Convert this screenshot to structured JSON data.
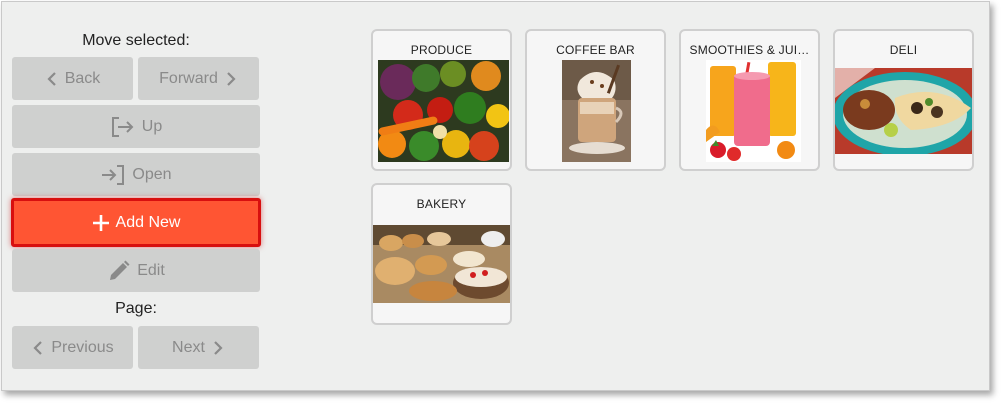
{
  "sidebar": {
    "move_label": "Move selected:",
    "back_label": "Back",
    "forward_label": "Forward",
    "up_label": "Up",
    "open_label": "Open",
    "add_new_label": "Add New",
    "edit_label": "Edit",
    "page_label": "Page:",
    "previous_label": "Previous",
    "next_label": "Next"
  },
  "colors": {
    "accent": "#ff5533",
    "accent_border": "#d80f0f",
    "button_bg": "#cfd0cf",
    "button_text": "#8a8a8a"
  },
  "tiles": [
    {
      "label": "PRODUCE",
      "icon": "produce-photo"
    },
    {
      "label": "COFFEE BAR",
      "icon": "coffee-photo"
    },
    {
      "label": "SMOOTHIES & JUI…",
      "icon": "smoothies-photo"
    },
    {
      "label": "DELI",
      "icon": "deli-photo"
    },
    {
      "label": "BAKERY",
      "icon": "bakery-photo"
    }
  ]
}
